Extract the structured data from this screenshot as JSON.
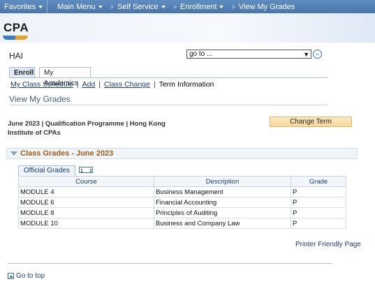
{
  "topnav": {
    "favorites": "Favorites",
    "main_menu": "Main Menu",
    "self_service": "Self Service",
    "enrollment": "Enrollment",
    "current": "View My Grades"
  },
  "banner": {
    "logo_text": "CPA"
  },
  "user": {
    "name": "HAI"
  },
  "goto": {
    "value": "go to ..."
  },
  "tabs": {
    "enroll": "Enroll",
    "academics": "My Academics"
  },
  "subnav": {
    "class_schedule": "My Class Schedule",
    "add": "Add",
    "class_change": "Class Change",
    "term_information": "Term Information"
  },
  "page": {
    "title": "View My Grades",
    "program": "June 2023 | Qualification Programme | Hong Kong Institute of CPAs",
    "change_term": "Change Term"
  },
  "class_grades": {
    "header": "Class Grades - June 2023",
    "grid_tab": "Official Grades",
    "columns": [
      "Course",
      "Description",
      "Grade"
    ],
    "rows": [
      [
        "MODULE 4",
        "Business Management",
        "P"
      ],
      [
        "MODULE 6",
        "Financial Accounting",
        "P"
      ],
      [
        "MODULE 8",
        "Principles of Auditing",
        "P"
      ],
      [
        "MODULE 10",
        "Business and Company Law",
        "P"
      ]
    ]
  },
  "footer": {
    "printer_friendly": "Printer Friendly Page",
    "go_to_top": "Go to top"
  },
  "colors": {
    "nav": "#4a75aa",
    "accent_orange": "#a55a16",
    "link": "#1a3c6e",
    "button": "#f8d79a"
  }
}
